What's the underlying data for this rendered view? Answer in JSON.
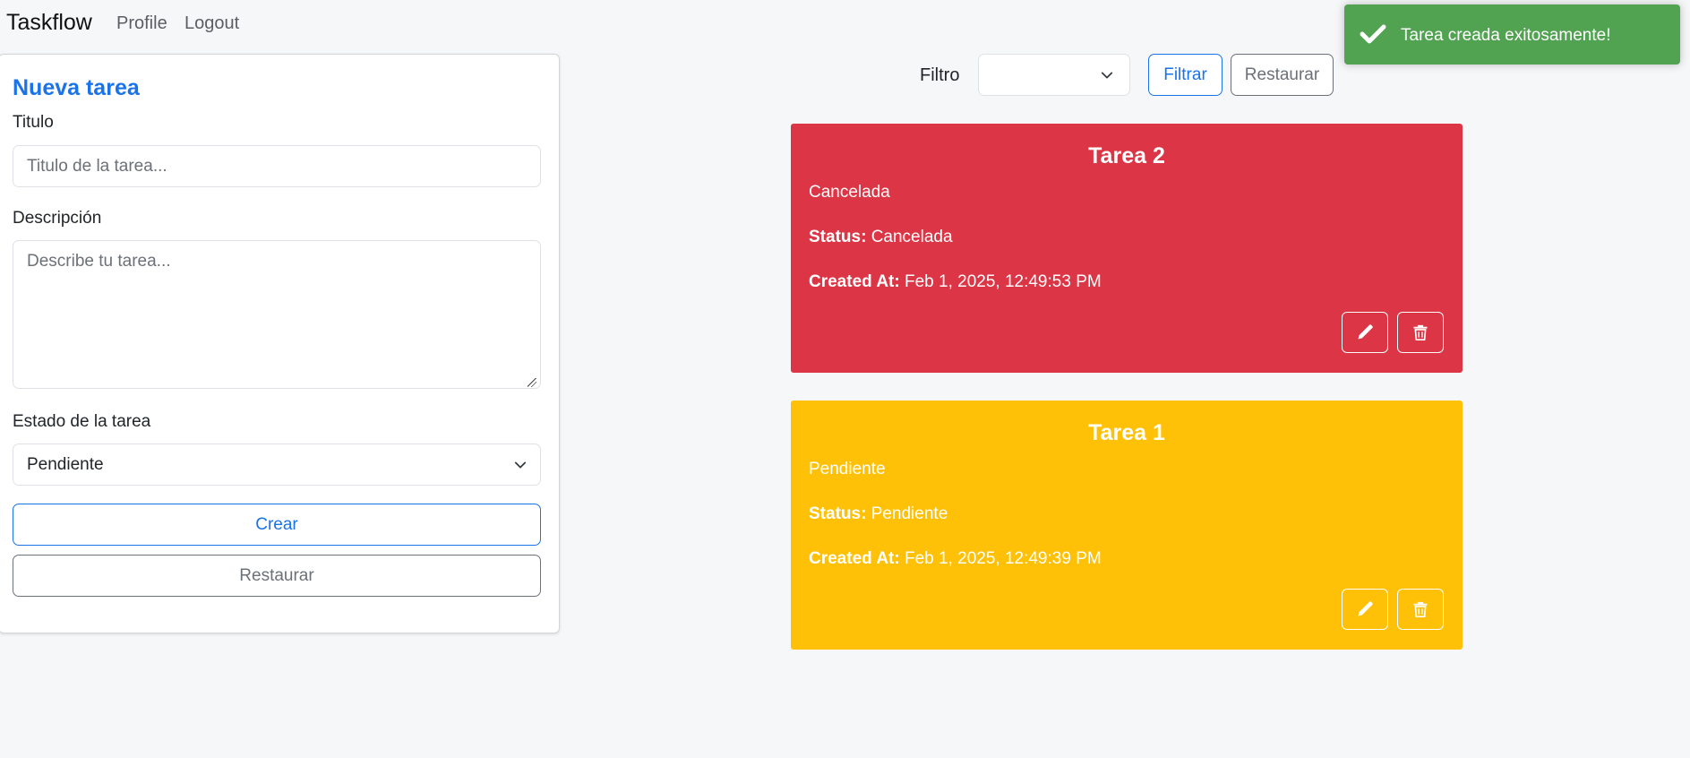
{
  "navbar": {
    "brand": "Taskflow",
    "links": [
      "Profile",
      "Logout"
    ]
  },
  "form": {
    "title": "Nueva tarea",
    "title_label": "Titulo",
    "title_placeholder": "Titulo de la tarea...",
    "desc_label": "Descripción",
    "desc_placeholder": "Describe tu tarea...",
    "state_label": "Estado de la tarea",
    "state_value": "Pendiente",
    "create_label": "Crear",
    "reset_label": "Restaurar"
  },
  "filter": {
    "label": "Filtro",
    "value": "",
    "filter_button": "Filtrar",
    "reset_button": "Restaurar"
  },
  "tasks": [
    {
      "title": "Tarea 2",
      "description": "Cancelada",
      "status_label": "Status:",
      "status": "Cancelada",
      "created_label": "Created At:",
      "created_at": "Feb 1, 2025, 12:49:53 PM",
      "color": "#dc3545"
    },
    {
      "title": "Tarea 1",
      "description": "Pendiente",
      "status_label": "Status:",
      "status": "Pendiente",
      "created_label": "Created At:",
      "created_at": "Feb 1, 2025, 12:49:39 PM",
      "color": "#ffc107"
    }
  ],
  "toast": {
    "message": "Tarea creada exitosamente!",
    "icon": "check-icon",
    "color": "#51a351"
  },
  "icons": {
    "edit": "pencil-icon",
    "delete": "trash-icon",
    "dropdown": "chevron-down-icon"
  }
}
